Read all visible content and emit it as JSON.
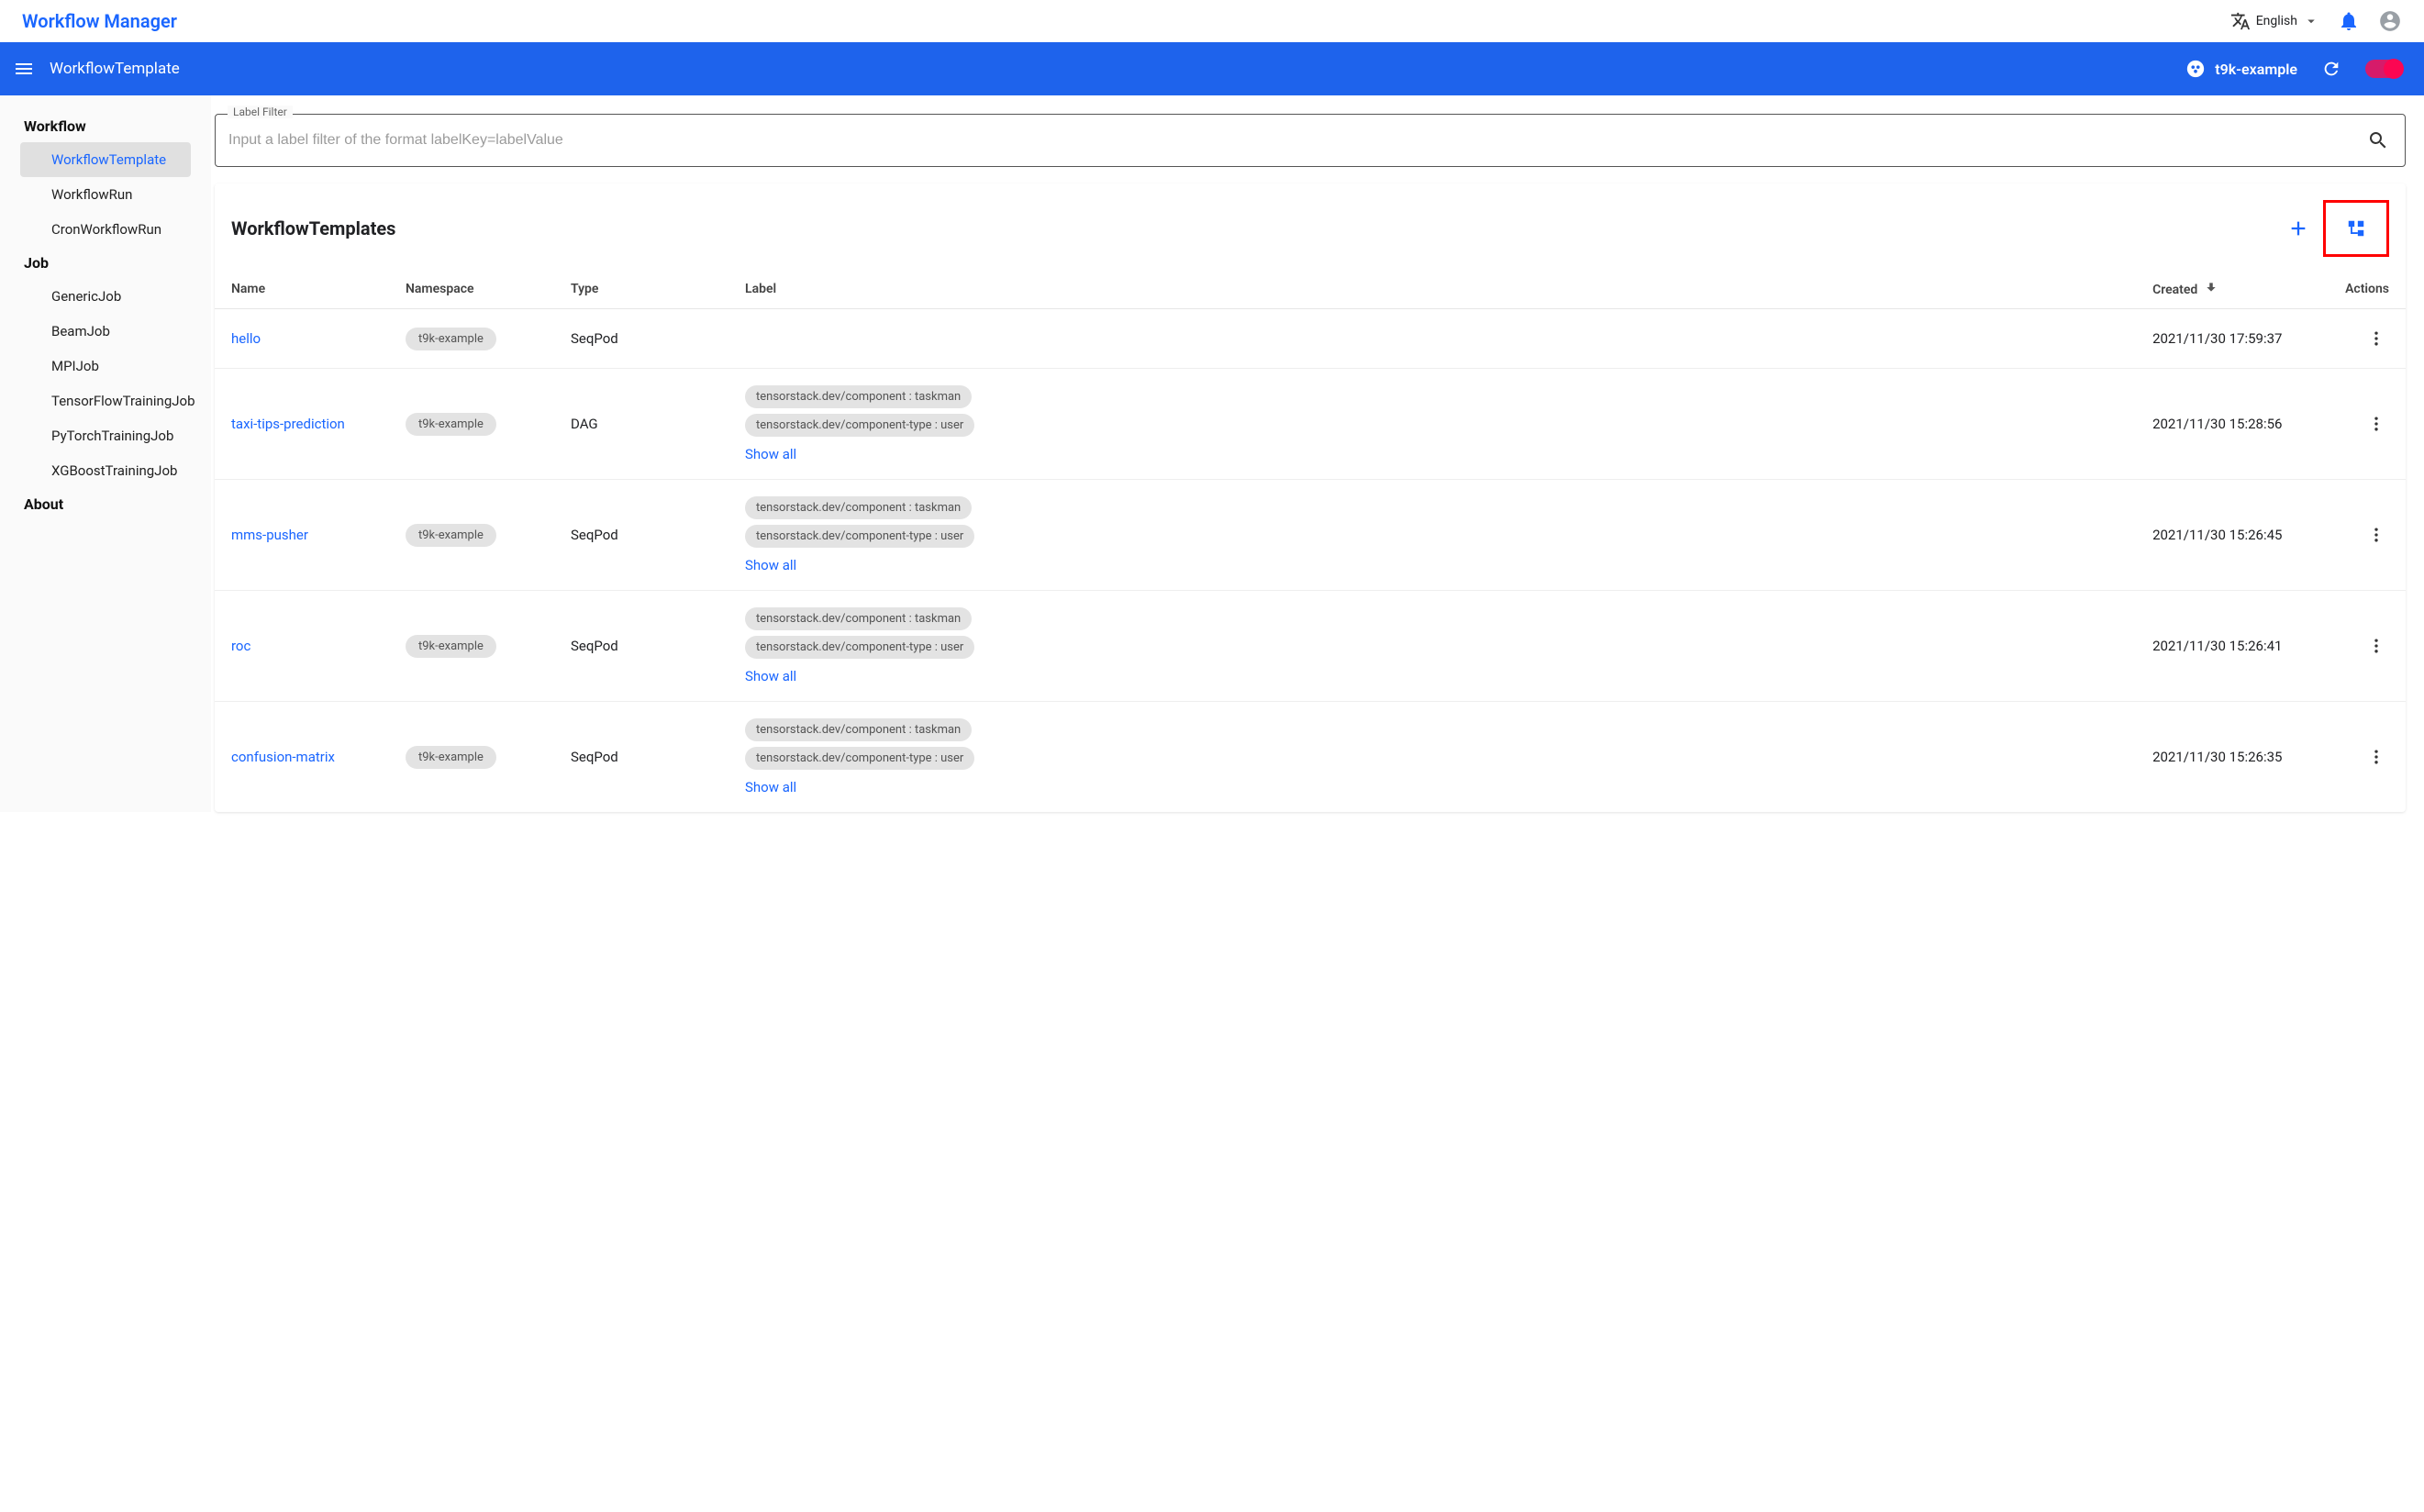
{
  "header": {
    "logo": "Workflow Manager",
    "language": "English"
  },
  "subheader": {
    "title": "WorkflowTemplate",
    "namespace": "t9k-example"
  },
  "sidebar": {
    "groups": [
      {
        "title": "Workflow",
        "items": [
          "WorkflowTemplate",
          "WorkflowRun",
          "CronWorkflowRun"
        ],
        "activeIndex": 0
      },
      {
        "title": "Job",
        "items": [
          "GenericJob",
          "BeamJob",
          "MPIJob",
          "TensorFlowTrainingJob",
          "PyTorchTrainingJob",
          "XGBoostTrainingJob"
        ],
        "activeIndex": -1
      },
      {
        "title": "About",
        "items": [],
        "activeIndex": -1
      }
    ]
  },
  "filter": {
    "legend": "Label Filter",
    "placeholder": "Input a label filter of the format labelKey=labelValue"
  },
  "panel": {
    "title": "WorkflowTemplates",
    "columns": {
      "name": "Name",
      "namespace": "Namespace",
      "type": "Type",
      "label": "Label",
      "created": "Created",
      "actions": "Actions"
    },
    "showAll": "Show all",
    "rows": [
      {
        "name": "hello",
        "namespace": "t9k-example",
        "type": "SeqPod",
        "labels": [],
        "created": "2021/11/30 17:59:37"
      },
      {
        "name": "taxi-tips-prediction",
        "namespace": "t9k-example",
        "type": "DAG",
        "labels": [
          "tensorstack.dev/component : taskman",
          "tensorstack.dev/component-type : user"
        ],
        "created": "2021/11/30 15:28:56"
      },
      {
        "name": "mms-pusher",
        "namespace": "t9k-example",
        "type": "SeqPod",
        "labels": [
          "tensorstack.dev/component : taskman",
          "tensorstack.dev/component-type : user"
        ],
        "created": "2021/11/30 15:26:45"
      },
      {
        "name": "roc",
        "namespace": "t9k-example",
        "type": "SeqPod",
        "labels": [
          "tensorstack.dev/component : taskman",
          "tensorstack.dev/component-type : user"
        ],
        "created": "2021/11/30 15:26:41"
      },
      {
        "name": "confusion-matrix",
        "namespace": "t9k-example",
        "type": "SeqPod",
        "labels": [
          "tensorstack.dev/component : taskman",
          "tensorstack.dev/component-type : user"
        ],
        "created": "2021/11/30 15:26:35"
      }
    ]
  }
}
